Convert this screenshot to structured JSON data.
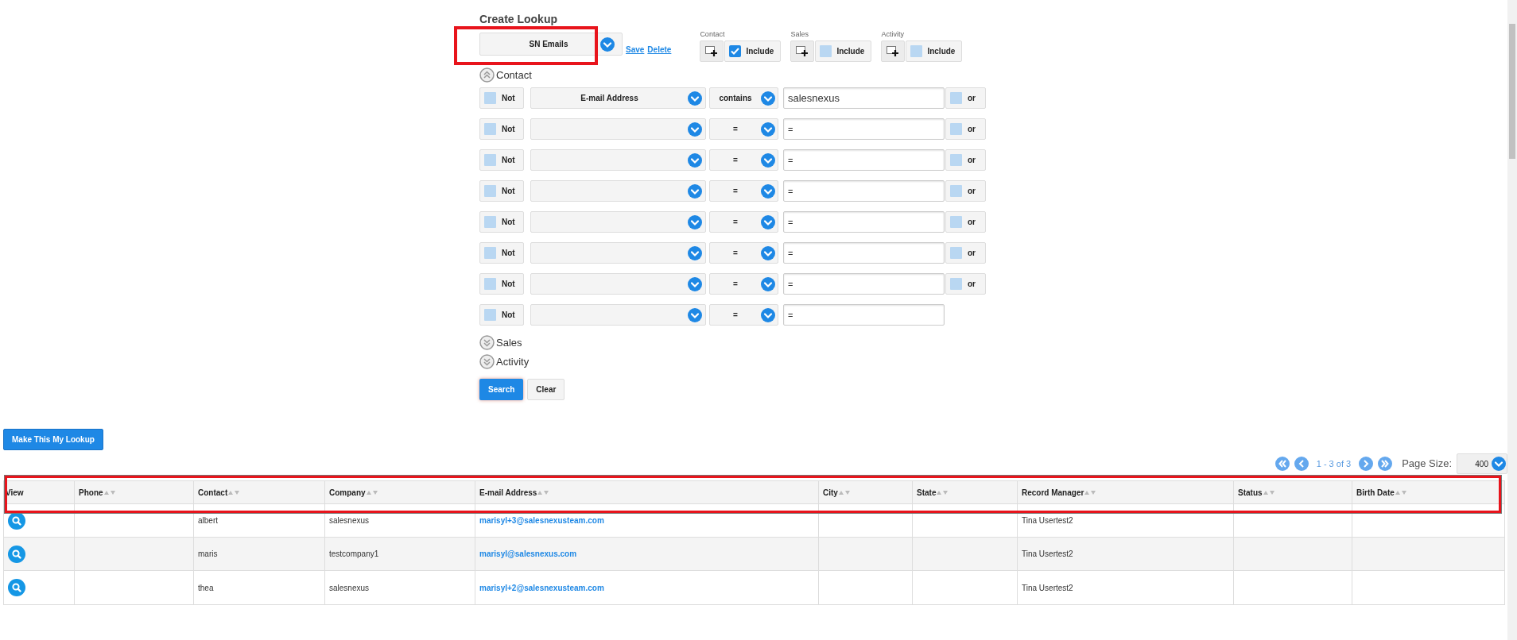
{
  "title": "Create Lookup",
  "lookup": {
    "value": "SN Emails",
    "links": [
      "Save",
      "Delete"
    ]
  },
  "include_groups": [
    {
      "label": "Contact",
      "option": "Include",
      "checked": true
    },
    {
      "label": "Sales",
      "option": "Include",
      "checked": false
    },
    {
      "label": "Activity",
      "option": "Include",
      "checked": false
    }
  ],
  "contact_section": {
    "title": "Contact",
    "expanded": true
  },
  "criteria": [
    {
      "not_label": "Not",
      "not": false,
      "field": "E-mail Address",
      "operator": "contains",
      "value": "salesnexus",
      "or_label": "or",
      "or": false
    },
    {
      "not_label": "Not",
      "not": false,
      "operator": "=",
      "value": "=",
      "or_label": "or",
      "or": false
    },
    {
      "not_label": "Not",
      "not": false,
      "operator": "=",
      "value": "=",
      "or_label": "or",
      "or": false
    },
    {
      "not_label": "Not",
      "not": false,
      "operator": "=",
      "value": "=",
      "or_label": "or",
      "or": false
    },
    {
      "not_label": "Not",
      "not": false,
      "operator": "=",
      "value": "=",
      "or_label": "or",
      "or": false
    },
    {
      "not_label": "Not",
      "not": false,
      "operator": "=",
      "value": "=",
      "or_label": "or",
      "or": false
    },
    {
      "not_label": "Not",
      "not": false,
      "operator": "=",
      "value": "=",
      "or_label": "or",
      "or": false
    },
    {
      "not_label": "Not",
      "not": false,
      "operator": "=",
      "value": "="
    }
  ],
  "other_sections": [
    {
      "title": "Sales",
      "expanded": false
    },
    {
      "title": "Activity",
      "expanded": false
    }
  ],
  "actions": [
    "Search",
    "Clear"
  ],
  "make_lookup_button": "Make This My Lookup",
  "pager": {
    "range": "1 - 3 of 3",
    "page_size_label": "Page Size:",
    "page_size": "400"
  },
  "table": {
    "columns": [
      {
        "label": "View",
        "kind": "view"
      },
      {
        "label": "Phone",
        "kind": "text"
      },
      {
        "label": "Contact",
        "kind": "text"
      },
      {
        "label": "Company",
        "kind": "text"
      },
      {
        "label": "E-mail Address",
        "kind": "link"
      },
      {
        "label": "City",
        "kind": "text"
      },
      {
        "label": "State",
        "kind": "text"
      },
      {
        "label": "Record Manager",
        "kind": "text"
      },
      {
        "label": "Status",
        "kind": "text"
      },
      {
        "label": "Birth Date",
        "kind": "text"
      }
    ],
    "rows": [
      {
        "cells": [
          null,
          null,
          "albert",
          "salesnexus",
          "marisyl+3@salesnexusteam.com",
          null,
          null,
          "Tina Usertest2",
          null,
          null
        ]
      },
      {
        "cells": [
          null,
          null,
          "maris",
          "testcompany1",
          "marisyl@salesnexus.com",
          null,
          null,
          "Tina Usertest2",
          null,
          null
        ]
      },
      {
        "cells": [
          null,
          null,
          "thea",
          "salesnexus",
          "marisyl+2@salesnexusteam.com",
          null,
          null,
          "Tina Usertest2",
          null,
          null
        ]
      }
    ]
  }
}
